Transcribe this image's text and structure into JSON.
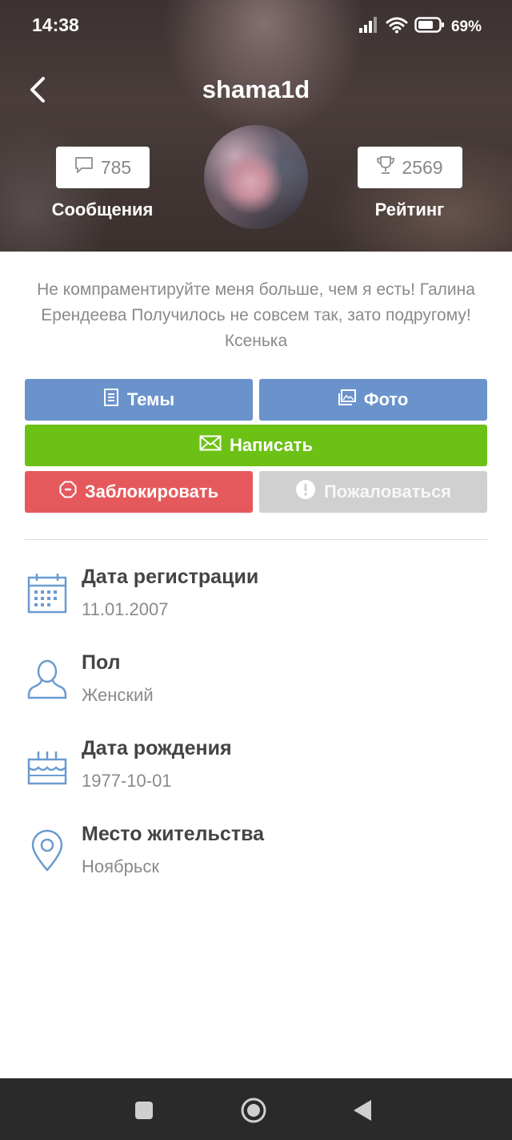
{
  "status_bar": {
    "time": "14:38",
    "battery": "69%"
  },
  "profile": {
    "username": "shama1d",
    "messages": {
      "count": "785",
      "label": "Сообщения"
    },
    "rating": {
      "count": "2569",
      "label": "Рейтинг"
    },
    "bio": "Не компраментируйте меня больше, чем я есть! Галина Ерендеева Получилось не совсем так, зато подругому! Ксенька"
  },
  "actions": {
    "topics": "Темы",
    "photo": "Фото",
    "write": "Написать",
    "block": "Заблокировать",
    "report": "Пожаловаться"
  },
  "info": {
    "registration": {
      "title": "Дата регистрации",
      "value": "11.01.2007"
    },
    "gender": {
      "title": "Пол",
      "value": "Женский"
    },
    "birthday": {
      "title": "Дата рождения",
      "value": "1977-10-01"
    },
    "location": {
      "title": "Место жительства",
      "value": "Ноябрьск"
    }
  },
  "colors": {
    "blue_button": "#6a93cc",
    "green_button": "#6cc115",
    "red_button": "#e5595c",
    "gray_button": "#d0d0d0",
    "icon_blue": "#6a9bd1"
  }
}
